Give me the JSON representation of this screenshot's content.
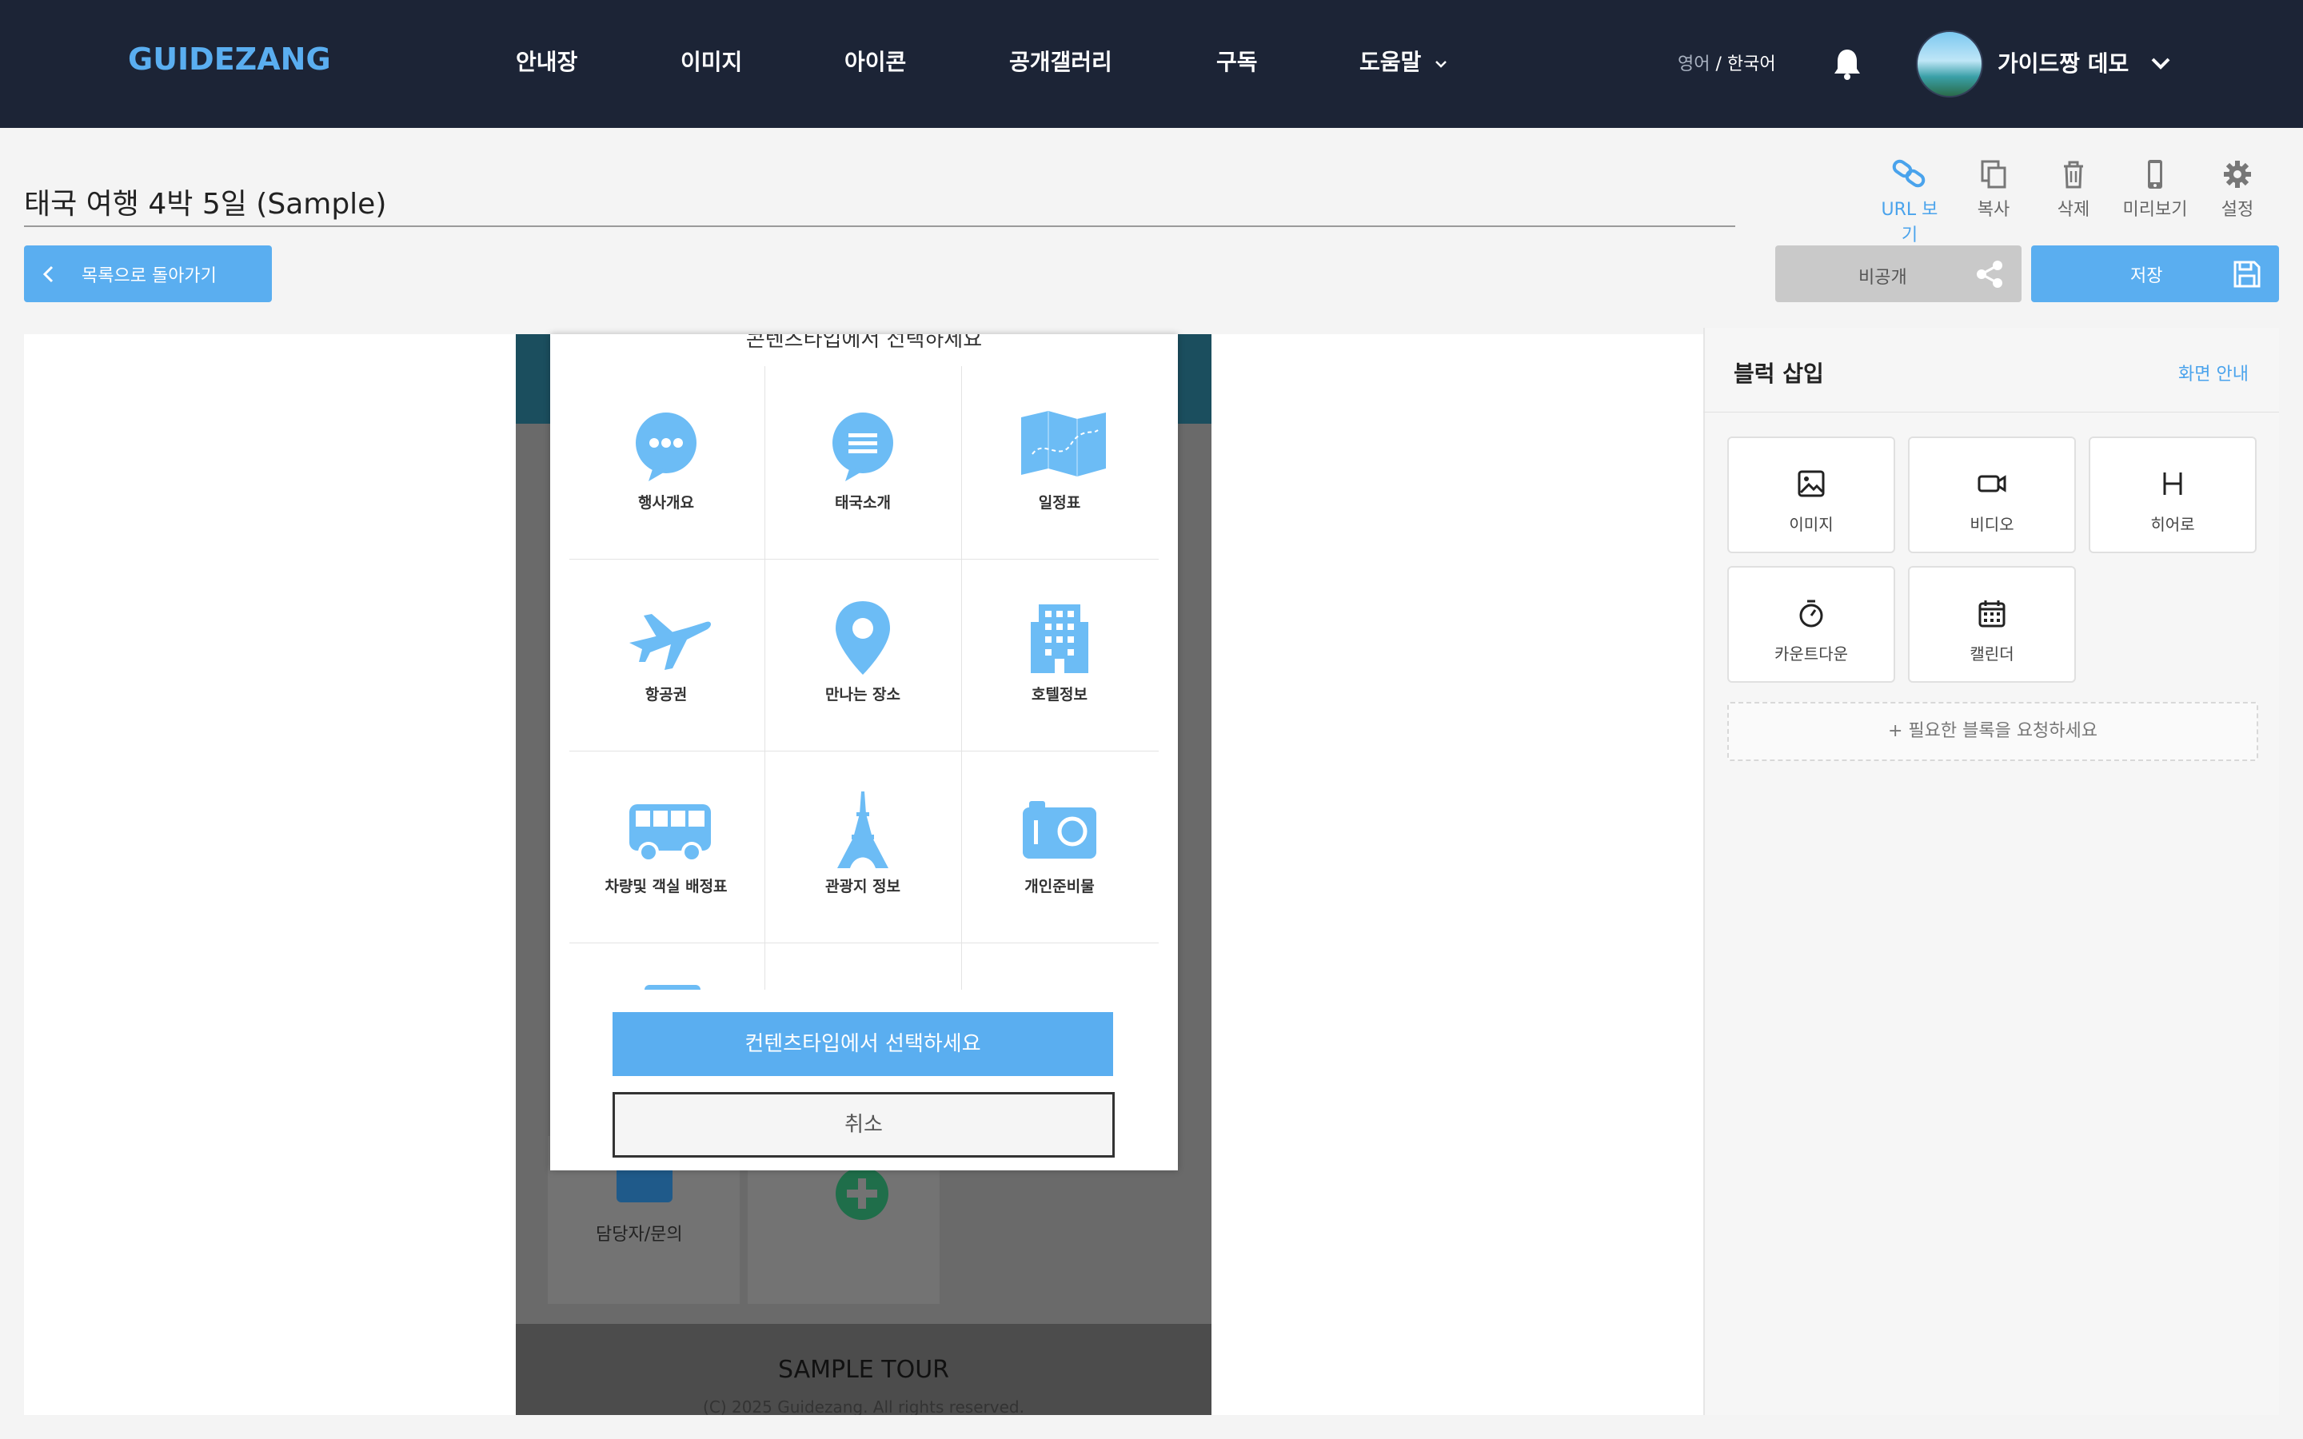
{
  "header": {
    "logo": "GUIDEZANG",
    "nav": [
      "안내장",
      "이미지",
      "아이콘",
      "공개갤러리",
      "구독",
      "도움말"
    ],
    "lang_english": "영어",
    "lang_separator": " / ",
    "lang_korean": "한국어",
    "username": "가이드짱 데모"
  },
  "page": {
    "title": "태국 여행 4박 5일 (Sample)"
  },
  "toolbar": {
    "url": "URL 보기",
    "copy": "복사",
    "delete": "삭제",
    "preview": "미리보기",
    "settings": "설정"
  },
  "actions": {
    "back": "목록으로 돌아가기",
    "private": "비공개",
    "save": "저장"
  },
  "phone": {
    "contact_label": "담당자/문의",
    "footer_title": "SAMPLE TOUR",
    "footer_copy": "(C) 2025 Guidezang. All rights reserved."
  },
  "modal": {
    "heading": "콘텐츠타입에서 선택하세요",
    "items": [
      {
        "label": "행사개요",
        "icon": "chat-dots-icon"
      },
      {
        "label": "태국소개",
        "icon": "chat-lines-icon"
      },
      {
        "label": "일정표",
        "icon": "map-icon"
      },
      {
        "label": "항공권",
        "icon": "airplane-icon"
      },
      {
        "label": "만나는 장소",
        "icon": "location-pin-icon"
      },
      {
        "label": "호텔정보",
        "icon": "building-icon"
      },
      {
        "label": "차량및 객실 배정표",
        "icon": "bus-icon"
      },
      {
        "label": "관광지 정보",
        "icon": "eiffel-tower-icon"
      },
      {
        "label": "개인준비물",
        "icon": "camera-icon"
      }
    ],
    "select_button": "컨텐츠타입에서 선택하세요",
    "cancel_button": "취소"
  },
  "panel": {
    "title": "블럭 삽입",
    "help": "화면 안내",
    "blocks": [
      {
        "label": "이미지",
        "icon": "image-icon"
      },
      {
        "label": "비디오",
        "icon": "video-icon"
      },
      {
        "label": "히어로",
        "icon": "heading-icon"
      },
      {
        "label": "카운트다운",
        "icon": "stopwatch-icon"
      },
      {
        "label": "캘린더",
        "icon": "calendar-icon"
      }
    ],
    "request": "+ 필요한 블록을 요청하세요"
  },
  "colors": {
    "header_bg": "#1c2436",
    "accent": "#5aaef0",
    "icon_blue": "#6cbcf5"
  }
}
